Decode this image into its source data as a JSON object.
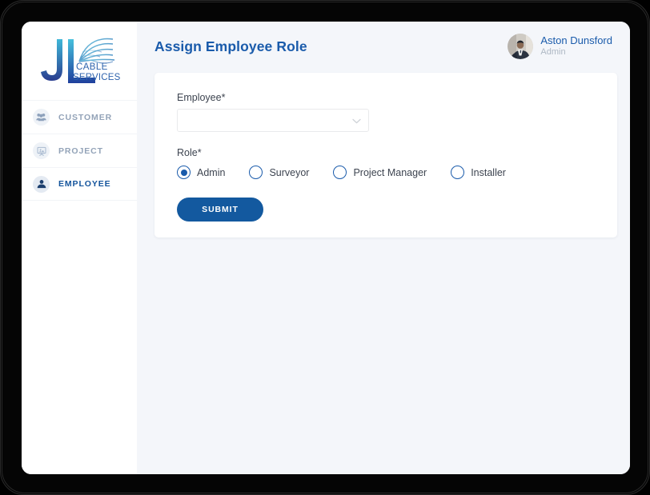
{
  "sidebar": {
    "logo": {
      "monogram": "JL",
      "line1": "CABLE",
      "line2": "SERVICES",
      "icon": "satellite-fan-icon"
    },
    "items": [
      {
        "label": "CUSTOMER",
        "icon": "users-group-icon",
        "active": false
      },
      {
        "label": "PROJECT",
        "icon": "presentation-board-icon",
        "active": false
      },
      {
        "label": "EMPLOYEE",
        "icon": "person-icon",
        "active": true
      }
    ]
  },
  "header": {
    "title": "Assign Employee Role",
    "user": {
      "name": "Aston Dunsford",
      "role": "Admin",
      "avatar_icon": "user-photo-avatar"
    }
  },
  "form": {
    "employee": {
      "label": "Employee*",
      "value": "",
      "placeholder": "",
      "chevron_icon": "chevron-down-icon"
    },
    "role": {
      "label": "Role*",
      "options": [
        {
          "label": "Admin",
          "selected": true
        },
        {
          "label": "Surveyor",
          "selected": false
        },
        {
          "label": "Project Manager",
          "selected": false
        },
        {
          "label": "Installer",
          "selected": false
        }
      ]
    },
    "submit_label": "SUBMIT"
  },
  "colors": {
    "accent_blue": "#1a5bab",
    "button_blue": "#13599f",
    "inactive_nav": "#93a3b8",
    "app_background": "#f4f6fa"
  }
}
